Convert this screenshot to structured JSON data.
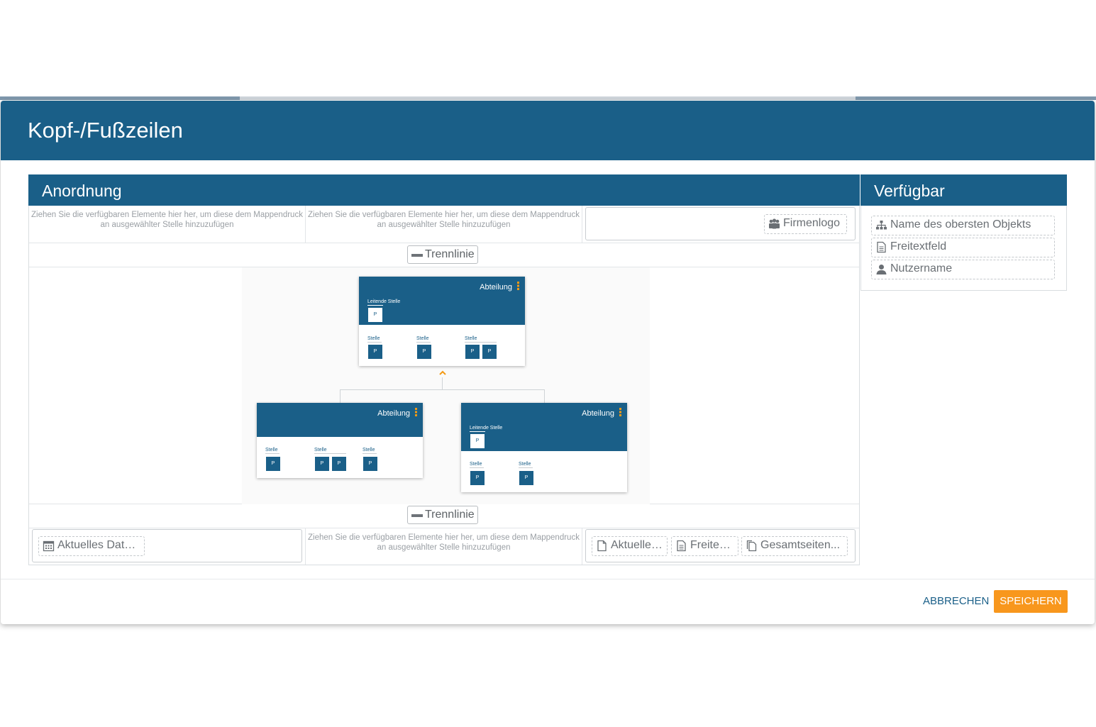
{
  "dialog": {
    "title": "Kopf-/Fußzeilen"
  },
  "arrangement": {
    "title": "Anordnung",
    "header_hint_left": "Ziehen Sie die verfügbaren Elemente hier her, um diese dem Mappendruck an ausgewählter Stelle hinzuzufügen",
    "header_hint_middle": "Ziehen Sie die verfügbaren Elemente hier her, um diese dem Mappendruck an ausgewählter Stelle hinzuzufügen",
    "header_right_chip": "Firmenlogo",
    "top_divider": "Trennlinie",
    "bottom_divider": "Trennlinie",
    "footer_left_chip": "Aktuelles Datum",
    "footer_hint_middle": "Ziehen Sie die verfügbaren Elemente hier her, um diese dem Mappendruck an ausgewählter Stelle hinzuzufügen",
    "footer_right_chips": [
      "Aktuelle ...",
      "Freitex...",
      "Gesamtseiten..."
    ]
  },
  "available": {
    "title": "Verfügbar",
    "items": [
      "Name des obersten Objekts",
      "Freitextfeld",
      "Nutzername"
    ]
  },
  "orgchart": {
    "cards": [
      {
        "title": "Abteilung",
        "lead_label": "Leitende Stelle",
        "lead_box": "P",
        "positions": [
          {
            "label": "Stelle",
            "boxes": [
              "P"
            ]
          },
          {
            "label": "Stelle",
            "boxes": [
              "P"
            ]
          },
          {
            "label": "Stelle",
            "boxes": [
              "P",
              "P"
            ]
          }
        ]
      },
      {
        "title": "Abteilung",
        "positions": [
          {
            "label": "Stelle",
            "boxes": [
              "P"
            ]
          },
          {
            "label": "Stelle",
            "boxes": [
              "P",
              "P"
            ]
          },
          {
            "label": "Stelle",
            "boxes": [
              "P"
            ]
          }
        ]
      },
      {
        "title": "Abteilung",
        "lead_label": "Leitende Stelle",
        "lead_box": "P",
        "positions": [
          {
            "label": "Stelle",
            "boxes": [
              "P"
            ]
          },
          {
            "label": "Stelle",
            "boxes": [
              "P"
            ]
          }
        ]
      }
    ],
    "collapse_icon": "chevron-up-icon",
    "accent_color": "#f39a15"
  },
  "actions": {
    "cancel": "ABBRECHEN",
    "save": "SPEICHERN"
  },
  "colors": {
    "primary": "#1a5f88",
    "accent": "#f8971d"
  }
}
